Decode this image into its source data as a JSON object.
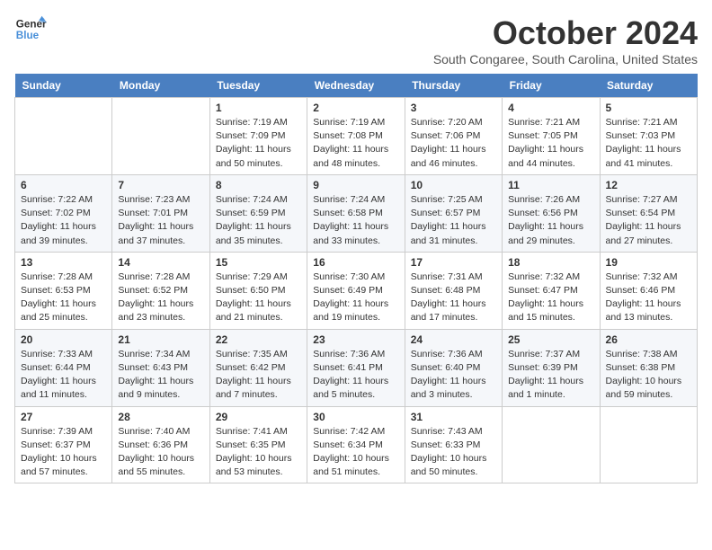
{
  "header": {
    "title": "October 2024",
    "location": "South Congaree, South Carolina, United States",
    "logo_line1": "General",
    "logo_line2": "Blue"
  },
  "weekdays": [
    "Sunday",
    "Monday",
    "Tuesday",
    "Wednesday",
    "Thursday",
    "Friday",
    "Saturday"
  ],
  "weeks": [
    [
      null,
      null,
      {
        "day": "1",
        "sunrise": "7:19 AM",
        "sunset": "7:09 PM",
        "daylight": "11 hours and 50 minutes."
      },
      {
        "day": "2",
        "sunrise": "7:19 AM",
        "sunset": "7:08 PM",
        "daylight": "11 hours and 48 minutes."
      },
      {
        "day": "3",
        "sunrise": "7:20 AM",
        "sunset": "7:06 PM",
        "daylight": "11 hours and 46 minutes."
      },
      {
        "day": "4",
        "sunrise": "7:21 AM",
        "sunset": "7:05 PM",
        "daylight": "11 hours and 44 minutes."
      },
      {
        "day": "5",
        "sunrise": "7:21 AM",
        "sunset": "7:03 PM",
        "daylight": "11 hours and 41 minutes."
      }
    ],
    [
      {
        "day": "6",
        "sunrise": "7:22 AM",
        "sunset": "7:02 PM",
        "daylight": "11 hours and 39 minutes."
      },
      {
        "day": "7",
        "sunrise": "7:23 AM",
        "sunset": "7:01 PM",
        "daylight": "11 hours and 37 minutes."
      },
      {
        "day": "8",
        "sunrise": "7:24 AM",
        "sunset": "6:59 PM",
        "daylight": "11 hours and 35 minutes."
      },
      {
        "day": "9",
        "sunrise": "7:24 AM",
        "sunset": "6:58 PM",
        "daylight": "11 hours and 33 minutes."
      },
      {
        "day": "10",
        "sunrise": "7:25 AM",
        "sunset": "6:57 PM",
        "daylight": "11 hours and 31 minutes."
      },
      {
        "day": "11",
        "sunrise": "7:26 AM",
        "sunset": "6:56 PM",
        "daylight": "11 hours and 29 minutes."
      },
      {
        "day": "12",
        "sunrise": "7:27 AM",
        "sunset": "6:54 PM",
        "daylight": "11 hours and 27 minutes."
      }
    ],
    [
      {
        "day": "13",
        "sunrise": "7:28 AM",
        "sunset": "6:53 PM",
        "daylight": "11 hours and 25 minutes."
      },
      {
        "day": "14",
        "sunrise": "7:28 AM",
        "sunset": "6:52 PM",
        "daylight": "11 hours and 23 minutes."
      },
      {
        "day": "15",
        "sunrise": "7:29 AM",
        "sunset": "6:50 PM",
        "daylight": "11 hours and 21 minutes."
      },
      {
        "day": "16",
        "sunrise": "7:30 AM",
        "sunset": "6:49 PM",
        "daylight": "11 hours and 19 minutes."
      },
      {
        "day": "17",
        "sunrise": "7:31 AM",
        "sunset": "6:48 PM",
        "daylight": "11 hours and 17 minutes."
      },
      {
        "day": "18",
        "sunrise": "7:32 AM",
        "sunset": "6:47 PM",
        "daylight": "11 hours and 15 minutes."
      },
      {
        "day": "19",
        "sunrise": "7:32 AM",
        "sunset": "6:46 PM",
        "daylight": "11 hours and 13 minutes."
      }
    ],
    [
      {
        "day": "20",
        "sunrise": "7:33 AM",
        "sunset": "6:44 PM",
        "daylight": "11 hours and 11 minutes."
      },
      {
        "day": "21",
        "sunrise": "7:34 AM",
        "sunset": "6:43 PM",
        "daylight": "11 hours and 9 minutes."
      },
      {
        "day": "22",
        "sunrise": "7:35 AM",
        "sunset": "6:42 PM",
        "daylight": "11 hours and 7 minutes."
      },
      {
        "day": "23",
        "sunrise": "7:36 AM",
        "sunset": "6:41 PM",
        "daylight": "11 hours and 5 minutes."
      },
      {
        "day": "24",
        "sunrise": "7:36 AM",
        "sunset": "6:40 PM",
        "daylight": "11 hours and 3 minutes."
      },
      {
        "day": "25",
        "sunrise": "7:37 AM",
        "sunset": "6:39 PM",
        "daylight": "11 hours and 1 minute."
      },
      {
        "day": "26",
        "sunrise": "7:38 AM",
        "sunset": "6:38 PM",
        "daylight": "10 hours and 59 minutes."
      }
    ],
    [
      {
        "day": "27",
        "sunrise": "7:39 AM",
        "sunset": "6:37 PM",
        "daylight": "10 hours and 57 minutes."
      },
      {
        "day": "28",
        "sunrise": "7:40 AM",
        "sunset": "6:36 PM",
        "daylight": "10 hours and 55 minutes."
      },
      {
        "day": "29",
        "sunrise": "7:41 AM",
        "sunset": "6:35 PM",
        "daylight": "10 hours and 53 minutes."
      },
      {
        "day": "30",
        "sunrise": "7:42 AM",
        "sunset": "6:34 PM",
        "daylight": "10 hours and 51 minutes."
      },
      {
        "day": "31",
        "sunrise": "7:43 AM",
        "sunset": "6:33 PM",
        "daylight": "10 hours and 50 minutes."
      },
      null,
      null
    ]
  ]
}
